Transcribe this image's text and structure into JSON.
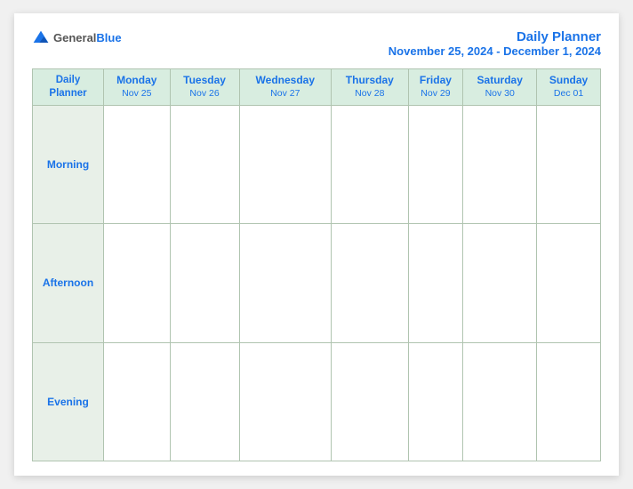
{
  "header": {
    "logo": {
      "general": "General",
      "blue": "Blue",
      "icon_label": "general-blue-logo"
    },
    "title": "Daily Planner",
    "date_range": "November 25, 2024 - December 1, 2024"
  },
  "table": {
    "header_label_line1": "Daily",
    "header_label_line2": "Planner",
    "columns": [
      {
        "day": "Monday",
        "date": "Nov 25"
      },
      {
        "day": "Tuesday",
        "date": "Nov 26"
      },
      {
        "day": "Wednesday",
        "date": "Nov 27"
      },
      {
        "day": "Thursday",
        "date": "Nov 28"
      },
      {
        "day": "Friday",
        "date": "Nov 29"
      },
      {
        "day": "Saturday",
        "date": "Nov 30"
      },
      {
        "day": "Sunday",
        "date": "Dec 01"
      }
    ],
    "rows": [
      {
        "label": "Morning"
      },
      {
        "label": "Afternoon"
      },
      {
        "label": "Evening"
      }
    ]
  }
}
